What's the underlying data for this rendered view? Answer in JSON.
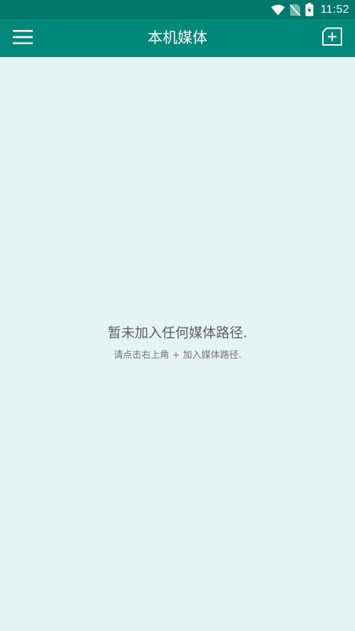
{
  "status_bar": {
    "time": "11:52",
    "icons": [
      "wifi-icon",
      "no-sim-icon",
      "battery-charging-icon"
    ]
  },
  "app_bar": {
    "title": "本机媒体",
    "left_icon": "hamburger-menu-icon",
    "right_icon": "add-folder-icon",
    "background_color": "#00897b",
    "status_bar_color": "#00796b"
  },
  "empty_state": {
    "title": "暂未加入任何媒体路径.",
    "hint": "请点击右上角 + 加入媒体路径."
  },
  "colors": {
    "page_background": "#e4f4f2",
    "title_text": "#616161",
    "hint_text": "#757575"
  }
}
